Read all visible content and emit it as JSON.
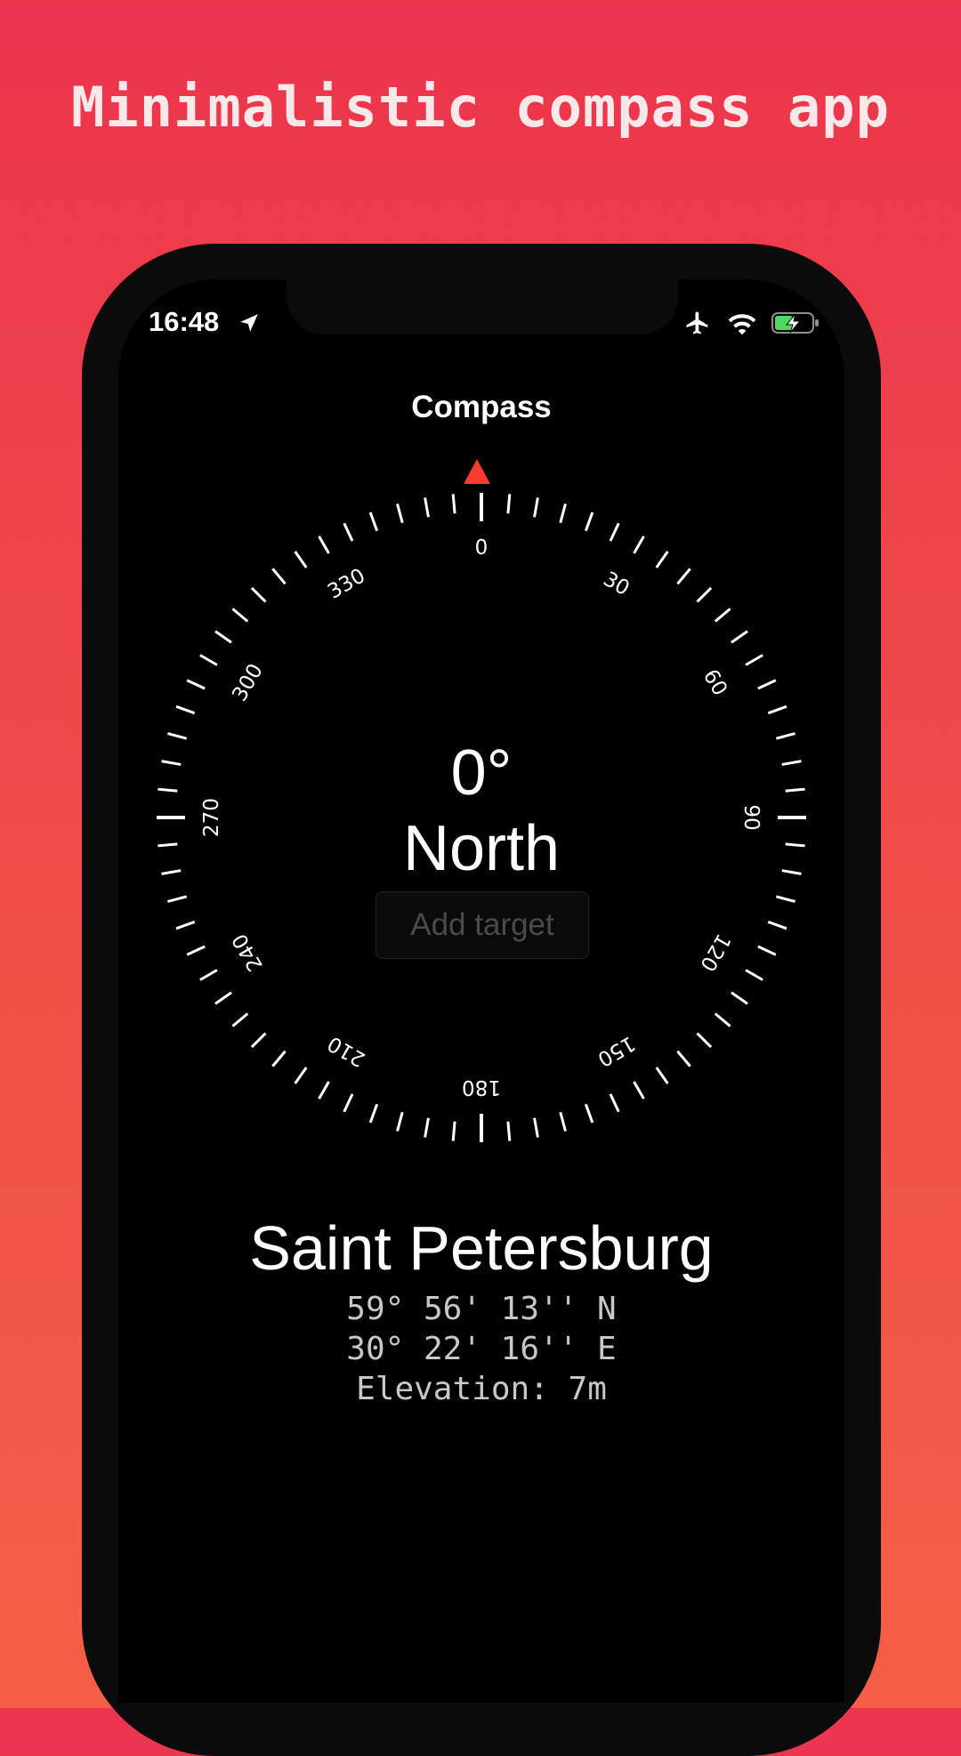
{
  "promo": {
    "title": "Minimalistic compass app"
  },
  "status_bar": {
    "time": "16:48",
    "icons": [
      "location-arrow-icon",
      "airplane-icon",
      "wifi-icon",
      "battery-charging-icon"
    ]
  },
  "nav": {
    "title": "Compass"
  },
  "compass": {
    "degree_labels": [
      "0",
      "30",
      "60",
      "90",
      "120",
      "150",
      "180",
      "210",
      "240",
      "270",
      "300",
      "330"
    ],
    "heading_degrees": "0°",
    "heading_direction": "North",
    "needle_color": "#ff3b30"
  },
  "add_target": {
    "label": "Add target"
  },
  "location": {
    "city": "Saint Petersburg",
    "latitude": "59° 56' 13'' N",
    "longitude": "30° 22' 16'' E",
    "elevation": "Elevation: 7m"
  },
  "colors": {
    "background_top": "#ec344e",
    "background_bottom": "#f45f46",
    "battery_fill": "#4cd964"
  }
}
